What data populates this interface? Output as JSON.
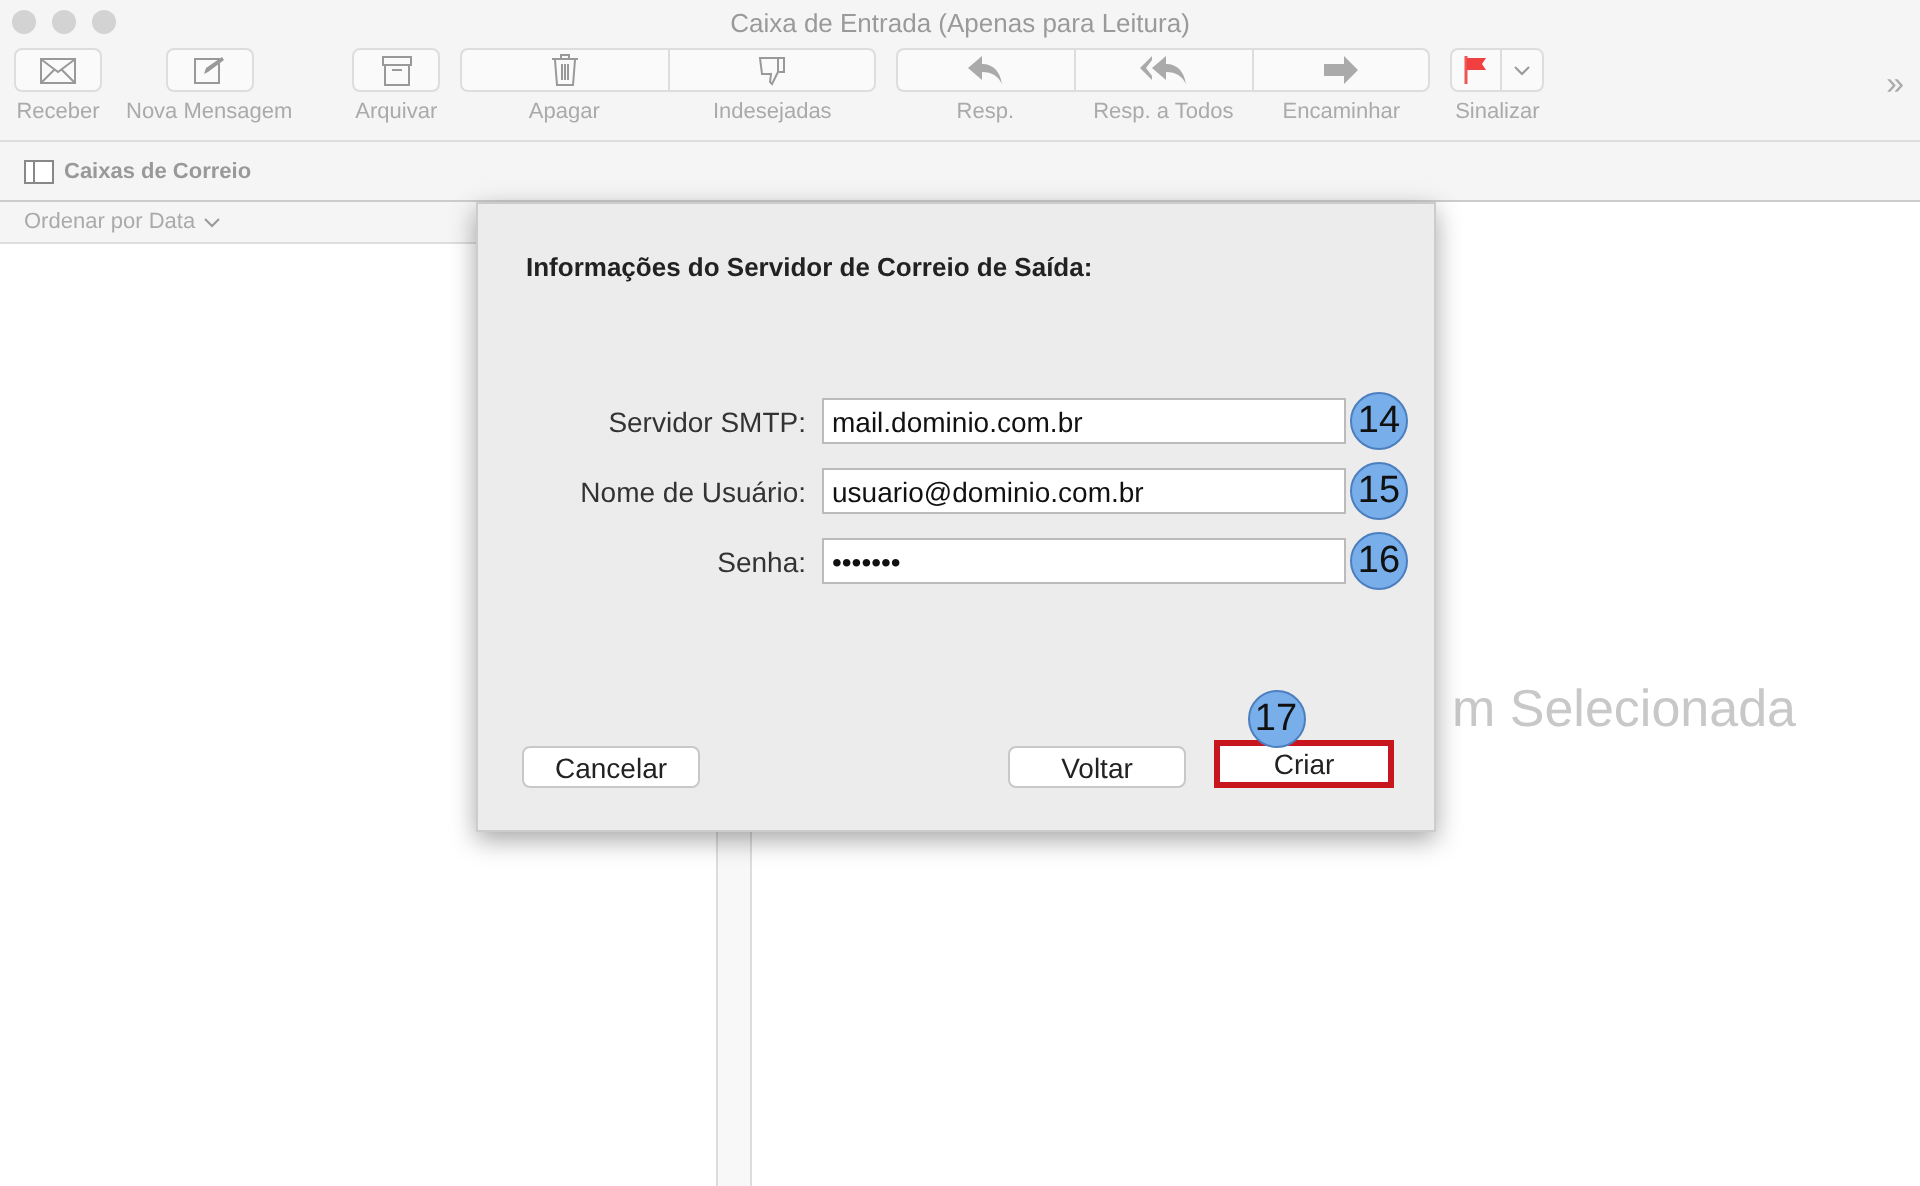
{
  "window": {
    "title": "Caixa de Entrada (Apenas para Leitura)"
  },
  "toolbar": {
    "groups": [
      {
        "items": [
          {
            "label": "Receber"
          }
        ]
      },
      {
        "items": [
          {
            "label": "Nova Mensagem"
          }
        ]
      },
      {
        "items": [
          {
            "label": "Arquivar"
          }
        ]
      },
      {
        "items": [
          {
            "label": "Apagar"
          },
          {
            "label": "Indesejadas"
          }
        ]
      },
      {
        "items": [
          {
            "label": "Resp."
          },
          {
            "label": "Resp. a Todos"
          },
          {
            "label": "Encaminhar"
          }
        ]
      },
      {
        "items": [
          {
            "label": "Sinalizar"
          }
        ]
      }
    ],
    "overflow": "»"
  },
  "mailbox_bar": {
    "label": "Caixas de Correio"
  },
  "message_list": {
    "sort": "Ordenar por Data"
  },
  "viewer": {
    "empty_text": "m Selecionada"
  },
  "dialog": {
    "title": "Informações do Servidor de Correio de Saída:",
    "fields": [
      {
        "label": "Servidor SMTP:",
        "value": "mail.dominio.com.br",
        "step": "14"
      },
      {
        "label": "Nome de Usuário:",
        "value": "usuario@dominio.com.br",
        "step": "15"
      },
      {
        "label": "Senha:",
        "value": "•••••••",
        "step": "16"
      }
    ],
    "buttons": [
      {
        "label": "Cancelar",
        "highlighted": false
      },
      {
        "label": "Voltar",
        "highlighted": false
      },
      {
        "label": "Criar",
        "highlighted": true,
        "step": "17"
      }
    ]
  }
}
